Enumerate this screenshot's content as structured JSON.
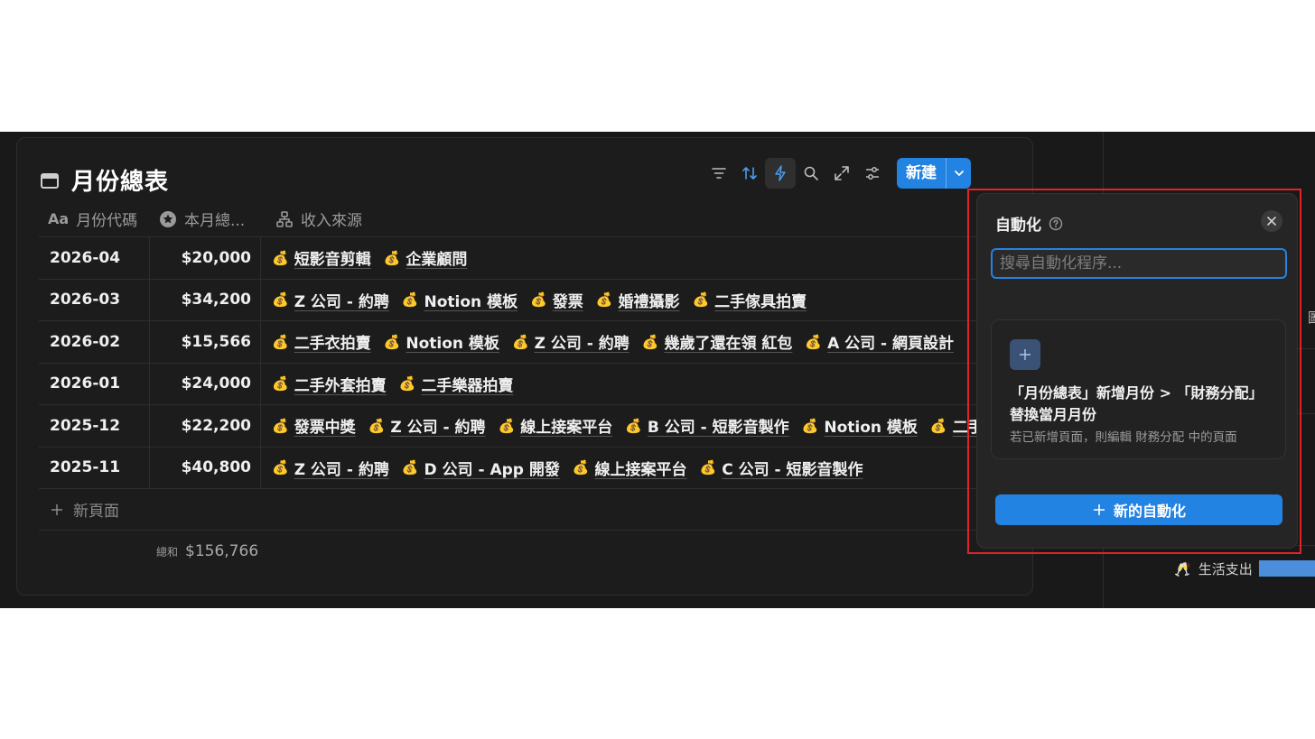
{
  "database": {
    "title": "月份總表",
    "new_button": "新建",
    "columns": [
      "月份代碼",
      "本月總...",
      "收入來源"
    ],
    "rows": [
      {
        "month": "2026-04",
        "total": "$20,000",
        "sources": [
          "短影音剪輯",
          "企業顧問"
        ]
      },
      {
        "month": "2026-03",
        "total": "$34,200",
        "sources": [
          "Z 公司 - 約聘",
          "Notion 模板",
          "發票",
          "婚禮攝影",
          "二手傢具拍賣"
        ]
      },
      {
        "month": "2026-02",
        "total": "$15,566",
        "sources": [
          "二手衣拍賣",
          "Notion 模板",
          "Z 公司 - 約聘",
          "幾歲了還在領 紅包",
          "A 公司 - 網頁設計"
        ]
      },
      {
        "month": "2026-01",
        "total": "$24,000",
        "sources": [
          "二手外套拍賣",
          "二手樂器拍賣"
        ]
      },
      {
        "month": "2025-12",
        "total": "$22,200",
        "sources": [
          "發票中獎",
          "Z 公司 - 約聘",
          "線上接案平台",
          "B 公司 - 短影音製作",
          "Notion 模板",
          "二手"
        ]
      },
      {
        "month": "2025-11",
        "total": "$40,800",
        "sources": [
          "Z 公司 - 約聘",
          "D 公司 - App 開發",
          "線上接案平台",
          "C 公司 - 短影音製作"
        ]
      }
    ],
    "new_page_label": "新頁面",
    "sum_label": "總和",
    "sum_value": "$156,766"
  },
  "right_panel": {
    "fragment": "圖",
    "life_label": "生活支出"
  },
  "automation": {
    "title": "自動化",
    "search_placeholder": "搜尋自動化程序...",
    "item_title": "「月份總表」新增月份 > 「財務分配」替換當月月份",
    "item_desc": "若已新增頁面，則編輯 財務分配 中的頁面",
    "new_button": "新的自動化"
  },
  "colors": {
    "accent": "#2383e2",
    "highlight": "#e0242a",
    "background": "#191919"
  }
}
